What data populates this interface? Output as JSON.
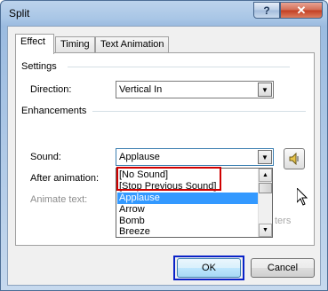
{
  "window": {
    "title": "Split",
    "help_glyph": "?",
    "close_glyph": "✕"
  },
  "tabs": [
    {
      "label": "Effect",
      "active": true
    },
    {
      "label": "Timing",
      "active": false
    },
    {
      "label": "Text Animation",
      "active": false
    }
  ],
  "settings": {
    "heading": "Settings",
    "direction_label": "Direction:",
    "direction_value": "Vertical In"
  },
  "enhancements": {
    "heading": "Enhancements",
    "sound_label": "Sound:",
    "sound_value": "Applause",
    "after_animation_label": "After animation:",
    "animate_text_label": "Animate text:",
    "trailing_text": "ters"
  },
  "sound_dropdown": {
    "items": [
      "[No Sound]",
      "[Stop Previous Sound]",
      "Applause",
      "Arrow",
      "Bomb",
      "Breeze"
    ],
    "selected": "Applause",
    "scroll_position": 0
  },
  "buttons": {
    "ok": "OK",
    "cancel": "Cancel"
  },
  "icons": {
    "sound_preview": "speaker-icon",
    "dropdown_arrow": "triangle-down-icon"
  },
  "colors": {
    "selection": "#3399ff",
    "highlight_box": "#d00000",
    "ok_frame": "#0a23c8"
  }
}
